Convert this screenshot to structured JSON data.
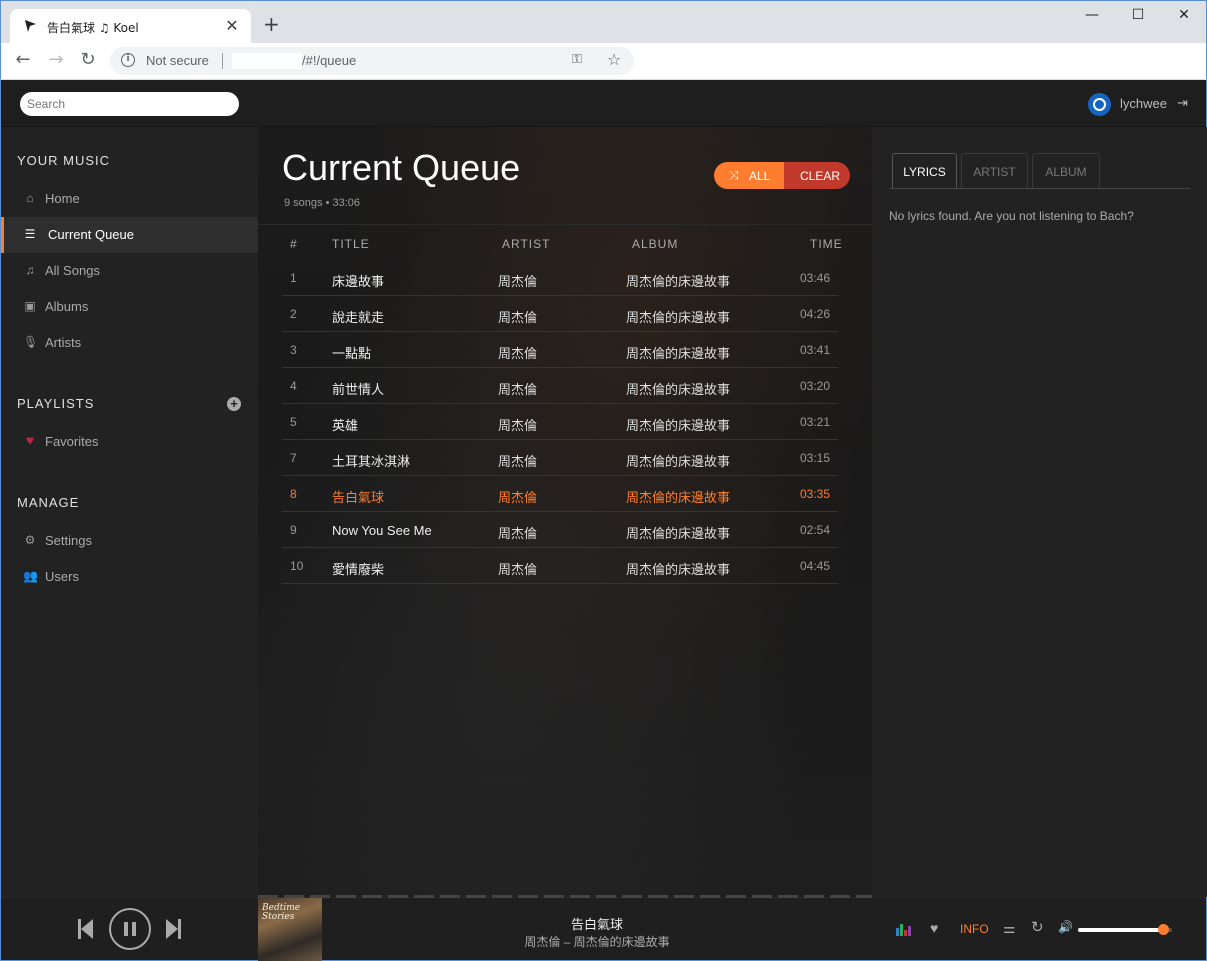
{
  "browser": {
    "tab_title": "告白氣球 ♫ Koel",
    "security": "Not secure",
    "url_path": "/#!/queue",
    "new_tab": "+",
    "tab_close": "✕",
    "minimize": "—",
    "maximize": "☐",
    "close": "✕"
  },
  "topbar": {
    "search_placeholder": "Search",
    "user_name": "lychwee"
  },
  "sidebar": {
    "your_music_heading": "YOUR MUSIC",
    "items": [
      {
        "label": "Home",
        "icon": "home-icon"
      },
      {
        "label": "Current Queue",
        "icon": "list-icon",
        "active": true
      },
      {
        "label": "All Songs",
        "icon": "music-note-icon"
      },
      {
        "label": "Albums",
        "icon": "album-icon"
      },
      {
        "label": "Artists",
        "icon": "microphone-icon"
      }
    ],
    "playlists_heading": "PLAYLISTS",
    "playlists": [
      {
        "label": "Favorites",
        "icon": "heart-icon"
      }
    ],
    "manage_heading": "MANAGE",
    "manage": [
      {
        "label": "Settings",
        "icon": "gear-icon"
      },
      {
        "label": "Users",
        "icon": "users-icon"
      }
    ]
  },
  "main": {
    "title": "Current Queue",
    "meta": "9 songs • 33:06",
    "shuffle_all_label": "ALL",
    "clear_label": "CLEAR",
    "columns": {
      "num": "#",
      "title": "TITLE",
      "artist": "ARTIST",
      "album": "ALBUM",
      "time": "TIME"
    },
    "songs": [
      {
        "num": "1",
        "title": "床邊故事",
        "artist": "周杰倫",
        "album": "周杰倫的床邊故事",
        "time": "03:46"
      },
      {
        "num": "2",
        "title": "說走就走",
        "artist": "周杰倫",
        "album": "周杰倫的床邊故事",
        "time": "04:26"
      },
      {
        "num": "3",
        "title": "一點點",
        "artist": "周杰倫",
        "album": "周杰倫的床邊故事",
        "time": "03:41"
      },
      {
        "num": "4",
        "title": "前世情人",
        "artist": "周杰倫",
        "album": "周杰倫的床邊故事",
        "time": "03:20"
      },
      {
        "num": "5",
        "title": "英雄",
        "artist": "周杰倫",
        "album": "周杰倫的床邊故事",
        "time": "03:21"
      },
      {
        "num": "7",
        "title": "土耳其冰淇淋",
        "artist": "周杰倫",
        "album": "周杰倫的床邊故事",
        "time": "03:15"
      },
      {
        "num": "8",
        "title": "告白氣球",
        "artist": "周杰倫",
        "album": "周杰倫的床邊故事",
        "time": "03:35",
        "playing": true
      },
      {
        "num": "9",
        "title": "Now You See Me",
        "artist": "周杰倫",
        "album": "周杰倫的床邊故事",
        "time": "02:54"
      },
      {
        "num": "10",
        "title": "愛情廢柴",
        "artist": "周杰倫",
        "album": "周杰倫的床邊故事",
        "time": "04:45"
      }
    ]
  },
  "extra": {
    "tabs": [
      "LYRICS",
      "ARTIST",
      "ALBUM"
    ],
    "active_tab": "LYRICS",
    "lyrics_text": "No lyrics found. Are you not listening to Bach?"
  },
  "player": {
    "now_playing_title": "告白氣球",
    "now_playing_sub": "周杰倫 – 周杰倫的床邊故事",
    "cover_text": "Bedtime Stories",
    "info_label": "INFO",
    "volume_level": 0.9,
    "state": "playing"
  },
  "colors": {
    "accent": "#ff7d2e",
    "clear": "#c0392b",
    "favorite": "#c02541",
    "user_badge": "#1565c0"
  }
}
